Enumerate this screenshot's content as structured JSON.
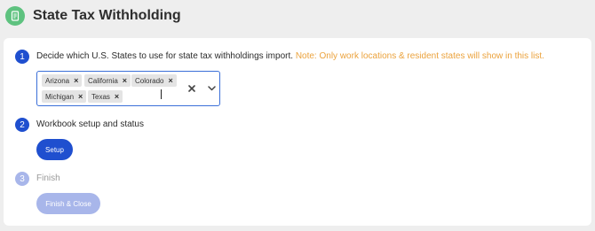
{
  "header": {
    "title": "State Tax Withholding",
    "icon": "document-icon",
    "icon_color": "#5ec27f"
  },
  "steps": [
    {
      "number": "1",
      "label": "Decide which U.S. States to use for state tax withholdings import.",
      "note": "Note: Only work locations & resident states will show in this list."
    },
    {
      "number": "2",
      "label": "Workbook setup and status",
      "button": "Setup"
    },
    {
      "number": "3",
      "label": "Finish",
      "button": "Finish & Close"
    }
  ],
  "states_select": {
    "selected": [
      "Arizona",
      "California",
      "Colorado",
      "Michigan",
      "Texas"
    ],
    "remove_glyph": "×"
  },
  "colors": {
    "primary": "#1f4fcf",
    "disabled": "#a8b6ea",
    "note": "#eba23c",
    "accent_border": "#3b6fd8"
  }
}
